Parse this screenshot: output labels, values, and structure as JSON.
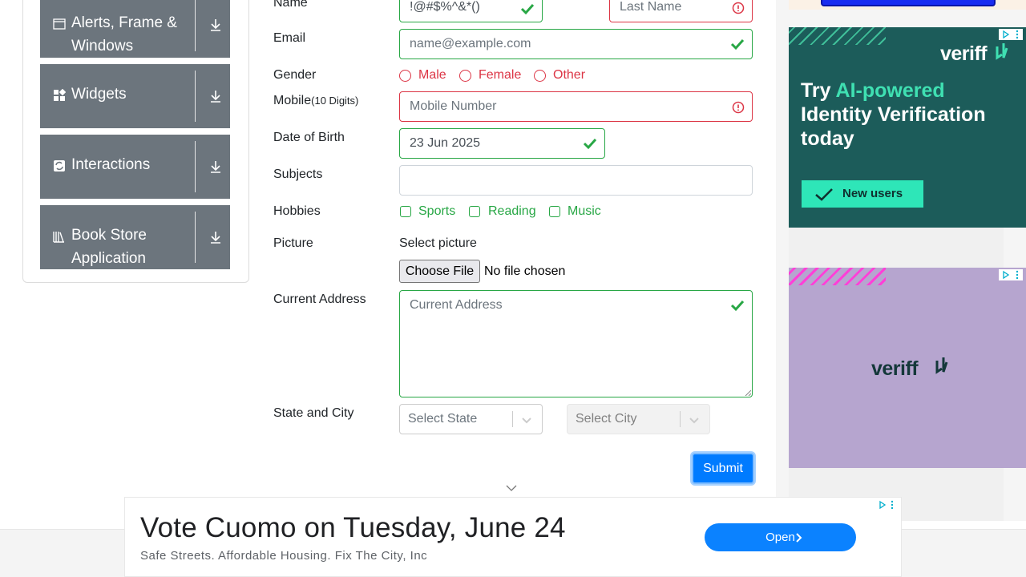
{
  "sidebar": {
    "groups": [
      {
        "label_line1": "Alerts, Frame &",
        "label_line2": "Windows",
        "icon": "window-icon"
      },
      {
        "label": "Widgets",
        "icon": "widgets-icon"
      },
      {
        "label": "Interactions",
        "icon": "interactions-icon"
      },
      {
        "label_line1": "Book Store",
        "label_line2": "Application",
        "icon": "books-icon"
      }
    ]
  },
  "form": {
    "name_label": "Name",
    "first_name_value": "!@#$%^&*()",
    "last_name_placeholder": "Last Name",
    "email_label": "Email",
    "email_placeholder": "name@example.com",
    "gender_label": "Gender",
    "gender_options": [
      "Male",
      "Female",
      "Other"
    ],
    "mobile_label": "Mobile",
    "mobile_hint": "(10 Digits)",
    "mobile_placeholder": "Mobile Number",
    "dob_label": "Date of Birth",
    "dob_value": "23 Jun 2025",
    "subjects_label": "Subjects",
    "hobbies_label": "Hobbies",
    "hobbies": [
      "Sports",
      "Reading",
      "Music"
    ],
    "picture_label": "Picture",
    "select_picture": "Select picture",
    "choose_file": "Choose File",
    "no_file": "No file chosen",
    "address_label": "Current Address",
    "address_placeholder": "Current Address",
    "state_city_label": "State and City",
    "state_placeholder": "Select State",
    "city_placeholder": "Select City",
    "submit": "Submit"
  },
  "ads": {
    "ad1": {
      "brand": "veriff",
      "headline_pre": "Try ",
      "headline_accent": "AI-powered",
      "headline_post": " Identity Verification today",
      "button": "New users",
      "colors": {
        "bg": "#1c5c5a",
        "accent": "#3fe0b2",
        "button": "#2ee6b8"
      }
    },
    "ad2": {
      "brand": "veriff",
      "colors": {
        "bg": "#b6a5cf"
      }
    },
    "bottom": {
      "headline": "Vote Cuomo on Tuesday, June 24",
      "subtext": "Safe Streets. Affordable Housing. Fix The City, Inc",
      "button": "Open"
    }
  },
  "colors": {
    "valid": "#28a745",
    "invalid": "#dc3545",
    "primary": "#007bff",
    "nav": "#6c757d"
  }
}
